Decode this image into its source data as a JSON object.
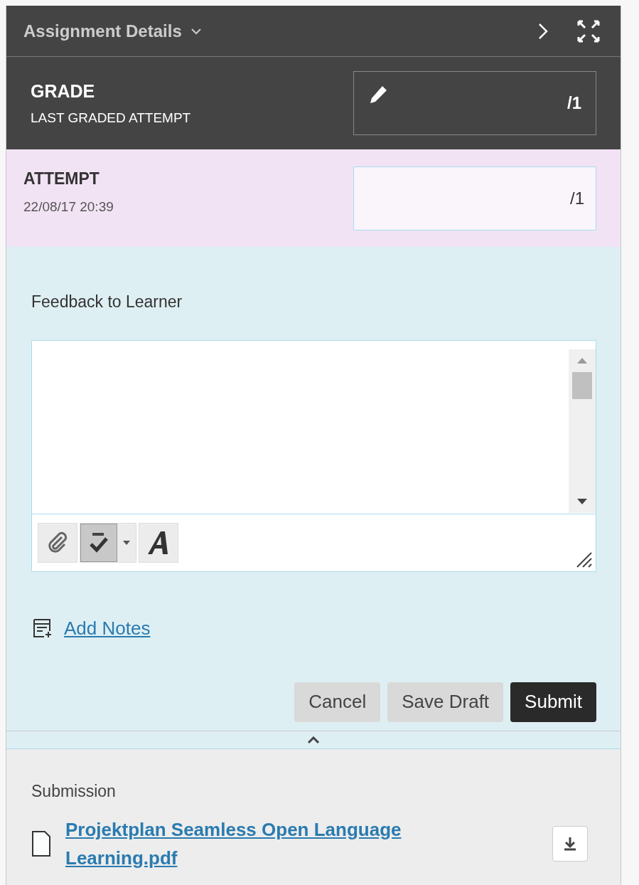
{
  "header": {
    "title": "Assignment Details"
  },
  "grade": {
    "title": "GRADE",
    "subtitle": "LAST GRADED ATTEMPT",
    "out_of": "/1"
  },
  "attempt": {
    "title": "ATTEMPT",
    "date": "22/08/17 20:39",
    "out_of": "/1"
  },
  "feedback": {
    "label": "Feedback to Learner",
    "spellcheck_active": true
  },
  "add_notes": "Add Notes",
  "buttons": [
    {
      "label": "Cancel",
      "kind": "secondary"
    },
    {
      "label": "Save Draft",
      "kind": "secondary"
    },
    {
      "label": "Submit",
      "kind": "primary"
    }
  ],
  "submission": {
    "label": "Submission",
    "file": "Projektplan Seamless Open Language Learning.pdf"
  }
}
